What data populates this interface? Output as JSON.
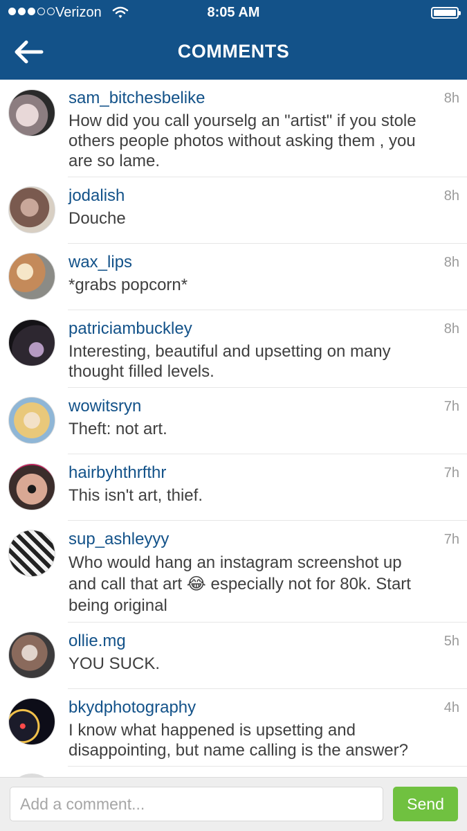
{
  "status_bar": {
    "carrier": "Verizon",
    "time": "8:05 AM",
    "signal_bars_filled": 3,
    "signal_bars_total": 5
  },
  "header": {
    "title": "COMMENTS",
    "back_icon": "back-arrow-icon",
    "background": "#135289"
  },
  "colors": {
    "username": "#135289",
    "send": "#70c140",
    "timestamp": "#9a9a9a"
  },
  "comments": [
    {
      "username": "sam_bitchesbelike",
      "time": "8h",
      "lines": [
        "How did you call yourselg an \"artist\" if you stole",
        "others people photos without asking them , you",
        "are so lame."
      ]
    },
    {
      "username": "jodalish",
      "time": "8h",
      "lines": [
        "Douche"
      ]
    },
    {
      "username": "wax_lips",
      "time": "8h",
      "lines": [
        "*grabs popcorn*"
      ]
    },
    {
      "username": "patriciambuckley",
      "time": "8h",
      "lines": [
        "Interesting, beautiful and upsetting on many",
        "thought filled levels."
      ]
    },
    {
      "username": "wowitsryn",
      "time": "7h",
      "lines": [
        "Theft: not art."
      ]
    },
    {
      "username": "hairbyhthrfthr",
      "time": "7h",
      "lines": [
        "This isn't art, thief."
      ]
    },
    {
      "username": "sup_ashleyyy",
      "time": "7h",
      "lines": [
        "Who would hang an instagram screenshot up",
        "and call that art 😂 especially not for 80k. Start",
        "being original"
      ]
    },
    {
      "username": "ollie.mg",
      "time": "5h",
      "lines": [
        "YOU SUCK."
      ]
    },
    {
      "username": "bkydphotography",
      "time": "4h",
      "lines": [
        "I know what happened is upsetting and",
        "disappointing, but name calling is the answer?"
      ]
    }
  ],
  "composer": {
    "placeholder": "Add a comment...",
    "send_label": "Send"
  }
}
